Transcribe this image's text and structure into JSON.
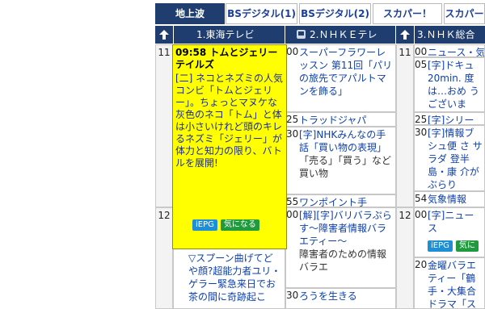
{
  "tabs": [
    "地上波",
    "BSデジタル(1)",
    "BSデジタル(2)",
    "スカパー！",
    "スカパー"
  ],
  "channels": [
    {
      "label": "1.東海テレビ"
    },
    {
      "label": "2.ＮＨＫＥテレ"
    },
    {
      "label": "3.ＮＨＫ総合"
    }
  ],
  "hours": [
    "11",
    "12"
  ],
  "col1": {
    "below_popup": "▽スプーン曲げてど\nや顔?超能力者ユリ・ゲラー緊急来日でお茶の間に奇跡起こ"
  },
  "col2": [
    {
      "m": "00",
      "t": "スーパーフラワーレッスン 第11回「パリの旅先でアパルトマンを飾る」"
    },
    {
      "m": "25",
      "t": "トラッドジャパ"
    },
    {
      "m": "30",
      "t": "[字]NHKみんなの手話「買い物の表現」",
      "d": "「売る」「買う」など買い物"
    },
    {
      "m": "55",
      "t": "ワンポイント手"
    },
    {
      "m": "00",
      "t": "[解][字]バリバラぷらす〜障害者情報バラエティー〜",
      "d": "障害者のための情報バラエ"
    },
    {
      "m": "30",
      "t": "ろうを生きる"
    }
  ],
  "col3": [
    {
      "m": "00",
      "t": "ニュース・気"
    },
    {
      "m": "05",
      "t": "[字]ドキュ 20min. 度は…おめ うございま"
    },
    {
      "m": "25",
      "t": "[字]シリー"
    },
    {
      "m": "30",
      "t": "[字]情報ブ シュ便 さ サラダ 登半島・康 介がぶらり"
    },
    {
      "m": "54",
      "t": "気象情報"
    },
    {
      "m": "00",
      "t": "[字]ニュース",
      "b1": "iEPG",
      "b2": "気に"
    },
    {
      "m": "20",
      "t": "金曜バラエ ティー「鶴 手・大集合 ドラマ「ス"
    }
  ],
  "popup": {
    "time": "09:58",
    "title": "トムとジェリー テイルズ",
    "body": "[二] ネコとネズミの人気コンビ「トムとジェリー」。ちょっとマヌケな灰色のネコ「トム」と体は小さいけれど頭のキレるネズミ「ジェリー」が体力と知力の限り、バトルを展開!",
    "btn_epg": "iEPG",
    "btn_ki": "気になる"
  },
  "colors": {
    "header_bg": "#1f3d6e",
    "popup_bg": "#ffff00",
    "link": "#0d3fae"
  }
}
